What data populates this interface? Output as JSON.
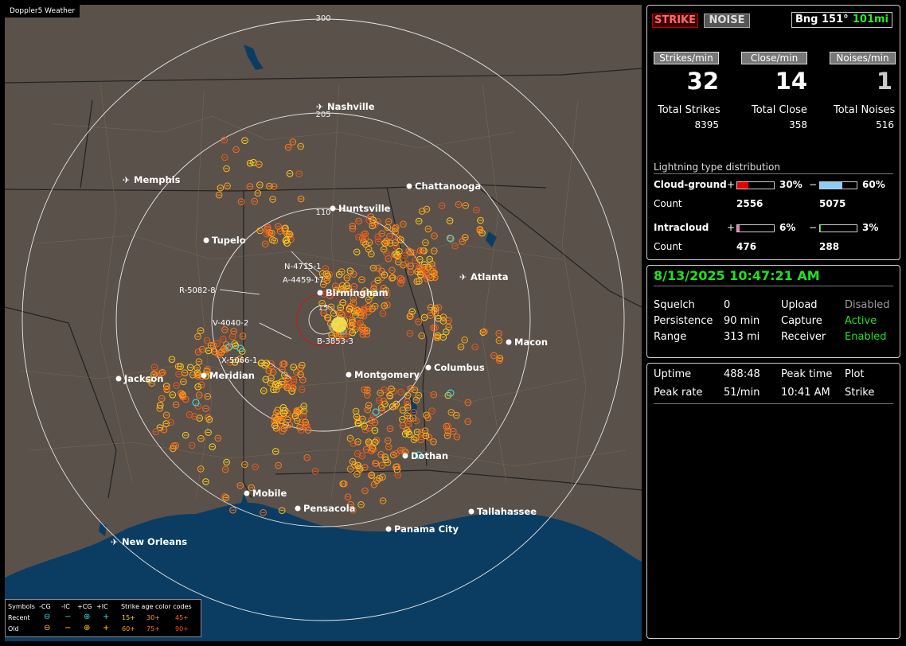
{
  "map": {
    "title": "Doppler5 Weather",
    "range_labels": [
      "300",
      "205",
      "110",
      "15"
    ],
    "cities": [
      {
        "name": "Nashville",
        "kind": "airport"
      },
      {
        "name": "Memphis",
        "kind": "airport"
      },
      {
        "name": "Chattanooga",
        "kind": "city"
      },
      {
        "name": "Huntsville",
        "kind": "city"
      },
      {
        "name": "Tupelo",
        "kind": "city"
      },
      {
        "name": "Atlanta",
        "kind": "airport"
      },
      {
        "name": "Birmingham",
        "kind": "city"
      },
      {
        "name": "Macon",
        "kind": "city"
      },
      {
        "name": "Jackson",
        "kind": "city"
      },
      {
        "name": "Meridian",
        "kind": "city"
      },
      {
        "name": "Montgomery",
        "kind": "city"
      },
      {
        "name": "Columbus",
        "kind": "city"
      },
      {
        "name": "Dothan",
        "kind": "city"
      },
      {
        "name": "Mobile",
        "kind": "city"
      },
      {
        "name": "Pensacola",
        "kind": "city"
      },
      {
        "name": "Tallahassee",
        "kind": "city"
      },
      {
        "name": "Panama City",
        "kind": "city"
      },
      {
        "name": "New Orleans",
        "kind": "airport"
      }
    ],
    "storm_labels": [
      "N-4715-1",
      "A-4459-17",
      "R-5082-8",
      "V-4040-2",
      "X-5066-1",
      "B-3853-3"
    ],
    "legend": {
      "symbols_label": "Symbols",
      "col_headers": [
        "-CG",
        "-IC",
        "+CG",
        "+IC"
      ],
      "age_title": "Strike age color codes",
      "recent_label": "Recent",
      "old_label": "Old",
      "recent_ages": [
        "15+",
        "30+",
        "45+"
      ],
      "old_ages": [
        "60+",
        "75+",
        "90+"
      ],
      "age_colors": [
        "#ffd21a",
        "#ff9f1a",
        "#ff6a1a"
      ]
    }
  },
  "top_panel": {
    "strike_btn": "STRIKE",
    "noise_btn": "NOISE",
    "bearing": "Bng 151°",
    "distance": "101mi",
    "strikes_per_min_label": "Strikes/min",
    "close_per_min_label": "Close/min",
    "noises_per_min_label": "Noises/min",
    "strikes_per_min": "32",
    "close_per_min": "14",
    "noises_per_min": "1",
    "total_strikes_label": "Total Strikes",
    "total_close_label": "Total Close",
    "total_noises_label": "Total Noises",
    "total_strikes": "8395",
    "total_close": "358",
    "total_noises": "516",
    "distribution_title": "Lightning type distribution",
    "cg_label": "Cloud-ground",
    "ic_label": "Intracloud",
    "count_label": "Count",
    "plus": "+",
    "minus": "−",
    "cg_pos_pct": "30%",
    "cg_neg_pct": "60%",
    "cg_pos_count": "2556",
    "cg_neg_count": "5075",
    "ic_pos_pct": "6%",
    "ic_neg_pct": "3%",
    "ic_pos_count": "476",
    "ic_neg_count": "288",
    "bar_fractions": {
      "cg_pos": 0.3,
      "cg_neg": 0.6,
      "ic_pos": 0.06,
      "ic_neg": 0.03
    },
    "bar_colors": {
      "cg_pos": "#e60000",
      "cg_neg": "#8ecdf5",
      "ic_pos": "#f07ab0",
      "ic_neg": "#22d022"
    }
  },
  "mid_panel": {
    "datetime": "8/13/2025 10:47:21 AM",
    "squelch_label": "Squelch",
    "squelch": "0",
    "persistence_label": "Persistence",
    "persistence": "90 min",
    "range_label": "Range",
    "range": "313 mi",
    "upload_label": "Upload",
    "upload": "Disabled",
    "capture_label": "Capture",
    "capture": "Active",
    "receiver_label": "Receiver",
    "receiver": "Enabled"
  },
  "bot_panel": {
    "uptime_label": "Uptime",
    "uptime": "488:48",
    "peak_time_label": "Peak time",
    "peak_time": "10:41 AM",
    "plot_label": "Plot",
    "plot": "Strike",
    "peak_rate_label": "Peak rate",
    "peak_rate": "51/min"
  }
}
